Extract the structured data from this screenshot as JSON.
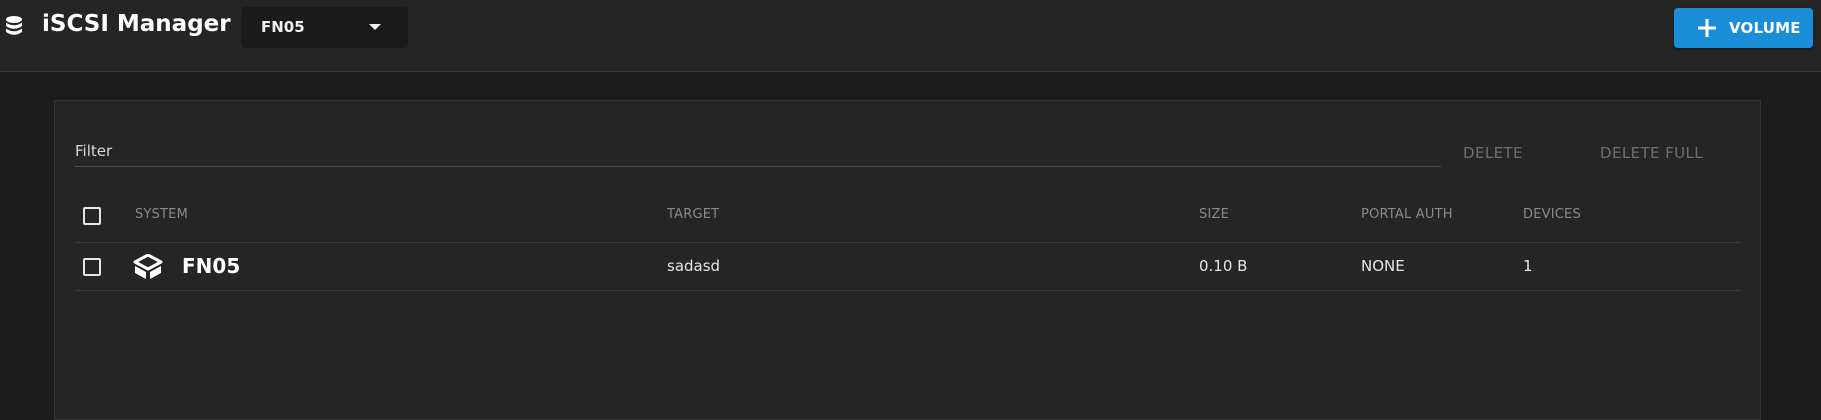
{
  "header": {
    "title": "iSCSI Manager",
    "app_icon": "database-icon",
    "system_select": {
      "value": "FN05",
      "caret_icon": "caret-down-icon"
    },
    "add_volume_button": {
      "label": "VOLUME",
      "icon": "plus-icon",
      "color": "#1a8ed8"
    }
  },
  "toolbar": {
    "filter_placeholder": "Filter",
    "delete_label": "DELETE",
    "delete_full_label": "DELETE FULL"
  },
  "table": {
    "columns": [
      "SYSTEM",
      "TARGET",
      "SIZE",
      "PORTAL AUTH",
      "DEVICES"
    ],
    "rows": [
      {
        "system": "FN05",
        "system_icon": "freenas-logo-icon",
        "target": "sadasd",
        "size": "0.10 B",
        "portal_auth": "NONE",
        "devices": "1"
      }
    ]
  }
}
